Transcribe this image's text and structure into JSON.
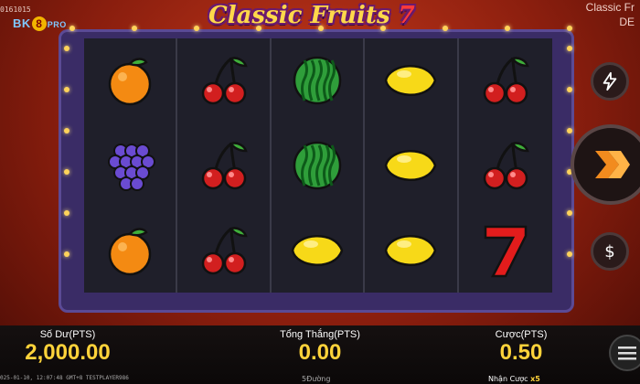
{
  "header": {
    "session_id": "0161015",
    "logo": {
      "part1": "BK",
      "number": "8",
      "part2": "PRO"
    },
    "game_title": "Classic Fruits",
    "game_title_seven": "7",
    "game_name_right_line1": "Classic Fr",
    "game_name_right_line2": "DE"
  },
  "reels": [
    [
      "orange",
      "grapes",
      "orange"
    ],
    [
      "cherry",
      "cherry",
      "cherry"
    ],
    [
      "watermelon",
      "watermelon",
      "lemon"
    ],
    [
      "lemon",
      "lemon",
      "lemon"
    ],
    [
      "cherry",
      "cherry",
      "seven"
    ]
  ],
  "controls": {
    "turbo_icon": "lightning-icon",
    "spin_icon": "spin-arrow-icon",
    "bet_icon": "dollar-icon",
    "menu_icon": "hamburger-icon"
  },
  "stats": {
    "balance_label": "Số Dư(PTS)",
    "balance_value": "2,000.00",
    "win_label": "Tổng Thắng(PTS)",
    "win_value": "0.00",
    "bet_label": "Cược(PTS)",
    "bet_value": "0.50"
  },
  "footer": {
    "info": "025-01-10, 12:07:48 GMT+8   TESTPLAYER986",
    "lines": "5Đường",
    "bonus_label": "Nhận Cược",
    "bonus_value": "x5"
  },
  "colors": {
    "accent": "#ffd33a",
    "background": "#8a1e0e",
    "frame": "#3a2c66"
  }
}
